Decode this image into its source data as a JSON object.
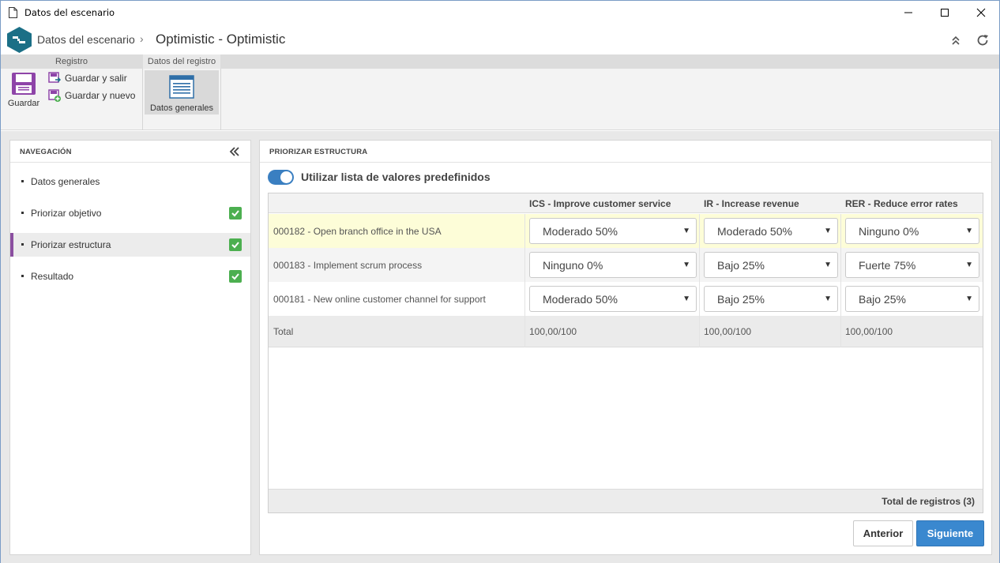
{
  "window": {
    "title": "Datos del escenario",
    "controls": [
      "minimize",
      "maximize",
      "close"
    ]
  },
  "header": {
    "breadcrumb_root": "Datos del escenario",
    "separator": "›",
    "title": "Optimistic - Optimistic"
  },
  "ribbon": {
    "tabs": [
      {
        "label": "Registro"
      },
      {
        "label": "Datos del registro"
      }
    ],
    "save_label": "Guardar",
    "save_exit_label": "Guardar y salir",
    "save_new_label": "Guardar y nuevo",
    "general_data_label": "Datos generales"
  },
  "navigation": {
    "title": "NAVEGACIÓN",
    "items": [
      {
        "label": "Datos generales",
        "done": false,
        "active": false
      },
      {
        "label": "Priorizar objetivo",
        "done": true,
        "active": false
      },
      {
        "label": "Priorizar estructura",
        "done": true,
        "active": true
      },
      {
        "label": "Resultado",
        "done": true,
        "active": false
      }
    ]
  },
  "content": {
    "title": "PRIORIZAR ESTRUCTURA",
    "toggle_label": "Utilizar lista de valores predefinidos",
    "toggle_on": true,
    "columns": [
      "",
      "ICS - Improve customer service",
      "IR - Increase revenue",
      "RER - Reduce error rates"
    ],
    "rows": [
      {
        "label": "000182 - Open branch office in the USA",
        "values": [
          "Moderado 50%",
          "Moderado 50%",
          "Ninguno 0%"
        ],
        "highlighted": true
      },
      {
        "label": "000183 - Implement scrum process",
        "values": [
          "Ninguno 0%",
          "Bajo 25%",
          "Fuerte 75%"
        ],
        "highlighted": false
      },
      {
        "label": "000181 - New online customer channel for support",
        "values": [
          "Moderado 50%",
          "Bajo 25%",
          "Bajo 25%"
        ],
        "highlighted": false
      }
    ],
    "total": {
      "label": "Total",
      "values": [
        "100,00/100",
        "100,00/100",
        "100,00/100"
      ]
    },
    "records_total": "Total de registros (3)",
    "prev_label": "Anterior",
    "next_label": "Siguiente"
  },
  "colors": {
    "accent": "#3a88cf",
    "active_marker": "#8b4fa0",
    "check_green": "#4caf50",
    "highlight_row": "#fdfdd8"
  }
}
